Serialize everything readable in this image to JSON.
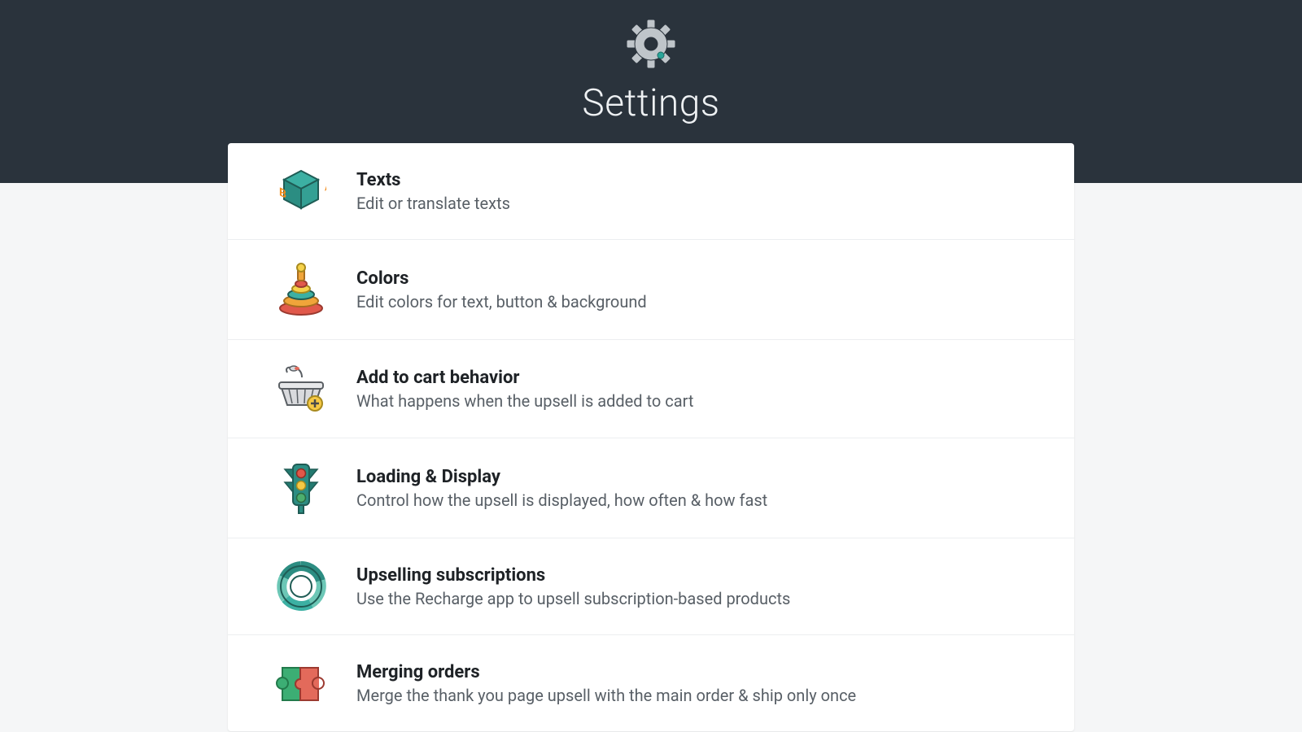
{
  "header": {
    "title": "Settings"
  },
  "items": [
    {
      "icon": "blocks-icon",
      "title": "Texts",
      "desc": "Edit or translate texts"
    },
    {
      "icon": "rings-icon",
      "title": "Colors",
      "desc": "Edit colors for text, button & background"
    },
    {
      "icon": "basket-icon",
      "title": "Add to cart behavior",
      "desc": "What happens when the upsell is added to cart"
    },
    {
      "icon": "traffic-light-icon",
      "title": "Loading & Display",
      "desc": "Control how the upsell is displayed, how often & how fast"
    },
    {
      "icon": "cycle-icon",
      "title": "Upselling subscriptions",
      "desc": "Use the Recharge app to upsell subscription-based products"
    },
    {
      "icon": "puzzle-icon",
      "title": "Merging orders",
      "desc": "Merge the thank you page upsell with the main order & ship only once"
    }
  ]
}
